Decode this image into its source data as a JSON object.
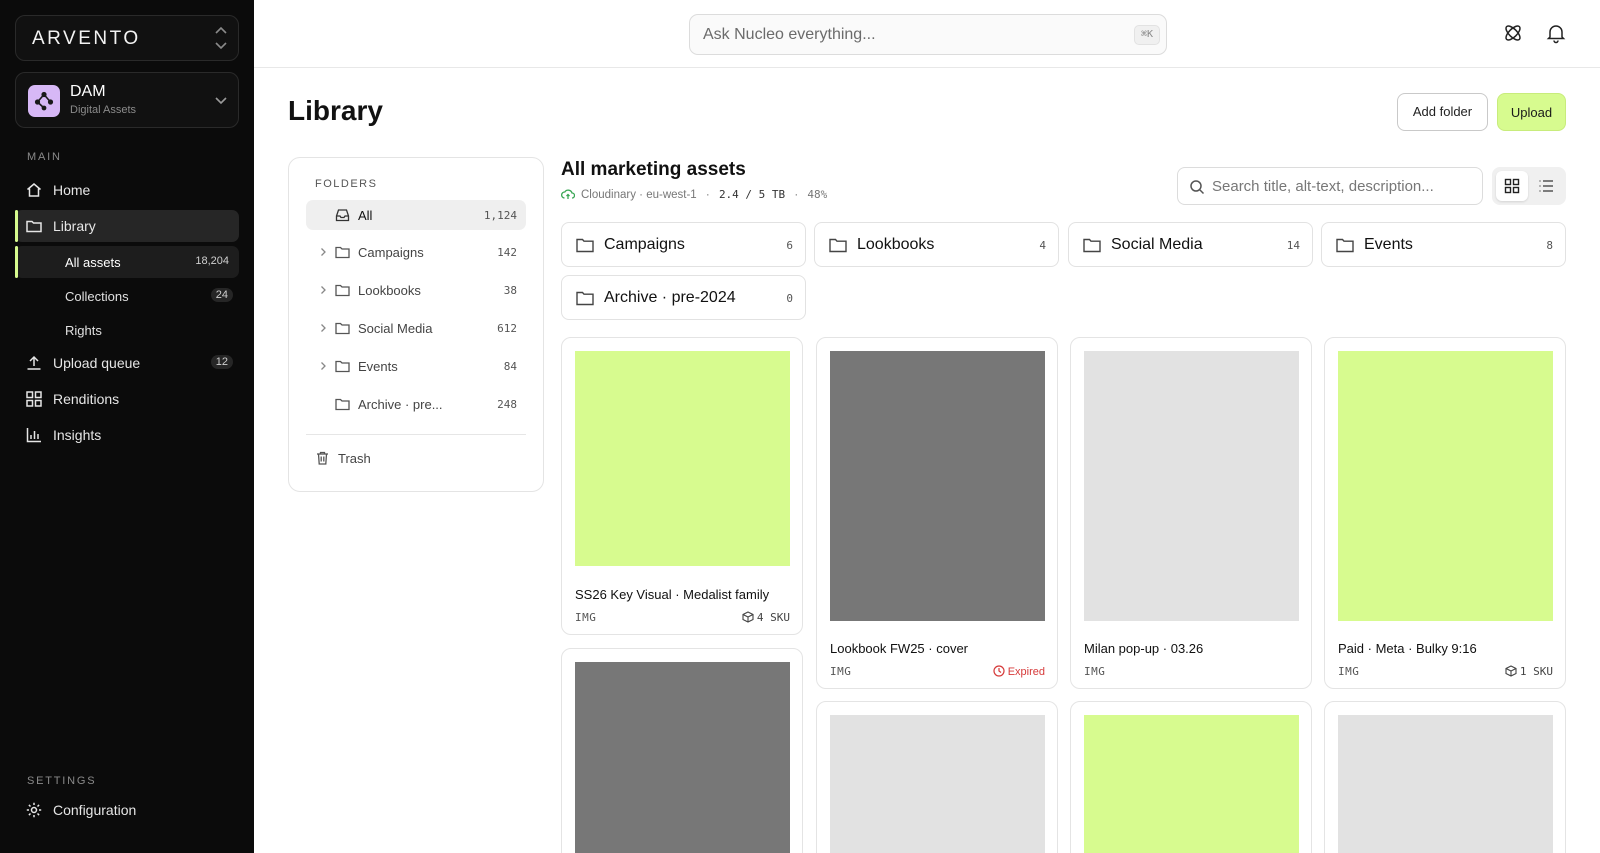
{
  "brand": {
    "name": "ARVENTO"
  },
  "workspace": {
    "title": "DAM",
    "subtitle": "Digital Assets"
  },
  "sidebar": {
    "main_label": "MAIN",
    "settings_label": "SETTINGS",
    "items": [
      {
        "label": "Home",
        "icon": "home-icon"
      },
      {
        "label": "Library",
        "icon": "folder-icon"
      },
      {
        "label": "Upload queue",
        "icon": "upload-icon",
        "count": "12"
      },
      {
        "label": "Renditions",
        "icon": "grid-icon"
      },
      {
        "label": "Insights",
        "icon": "bar-chart-icon"
      }
    ],
    "library_sub": [
      {
        "label": "All assets",
        "count": "18,204"
      },
      {
        "label": "Collections",
        "count": "24"
      },
      {
        "label": "Rights"
      }
    ],
    "settings_items": [
      {
        "label": "Configuration",
        "icon": "gear-icon"
      }
    ]
  },
  "topbar": {
    "search_placeholder": "Ask Nucleo everything...",
    "shortcut": "⌘K"
  },
  "page": {
    "title": "Library",
    "add_folder": "Add folder",
    "upload": "Upload"
  },
  "folders_panel": {
    "label": "FOLDERS",
    "items": [
      {
        "label": "All",
        "count": "1,124"
      },
      {
        "label": "Campaigns",
        "count": "142"
      },
      {
        "label": "Lookbooks",
        "count": "38"
      },
      {
        "label": "Social Media",
        "count": "612"
      },
      {
        "label": "Events",
        "count": "84"
      },
      {
        "label": "Archive · pre...",
        "count": "248"
      }
    ],
    "trash": "Trash"
  },
  "collection": {
    "title": "All marketing assets",
    "provider": "Cloudinary · eu-west-1",
    "storage": "2.4 / 5 TB",
    "usage": "48%",
    "search_placeholder": "Search title, alt-text, description..."
  },
  "folder_tiles": [
    {
      "label": "Campaigns",
      "count": "6"
    },
    {
      "label": "Lookbooks",
      "count": "4"
    },
    {
      "label": "Social Media",
      "count": "14"
    },
    {
      "label": "Events",
      "count": "8"
    },
    {
      "label": "Archive · pre-2024",
      "count": "0"
    }
  ],
  "assets": [
    {
      "title": "SS26 Key Visual · Medalist family",
      "type": "IMG",
      "badge": "4 SKU",
      "thumb_color": "#d7fb8f"
    },
    {
      "title": "Lookbook FW25 · cover",
      "type": "IMG",
      "badge": "Expired",
      "thumb_color": "#777777"
    },
    {
      "title": "Milan pop-up · 03.26",
      "type": "IMG",
      "badge": "",
      "thumb_color": "#e2e2e2"
    },
    {
      "title": "Paid · Meta · Bulky 9:16",
      "type": "IMG",
      "badge": "1 SKU",
      "thumb_color": "#d7fb8f"
    },
    {
      "thumb_color": "#777777"
    },
    {
      "thumb_color": "#e2e2e2"
    },
    {
      "thumb_color": "#d7fb8f"
    },
    {
      "thumb_color": "#e2e2e2"
    }
  ],
  "colors": {
    "accent": "#d7fb8f",
    "expired": "#d63a3a",
    "sidebar_bg": "#0b0b0b"
  }
}
